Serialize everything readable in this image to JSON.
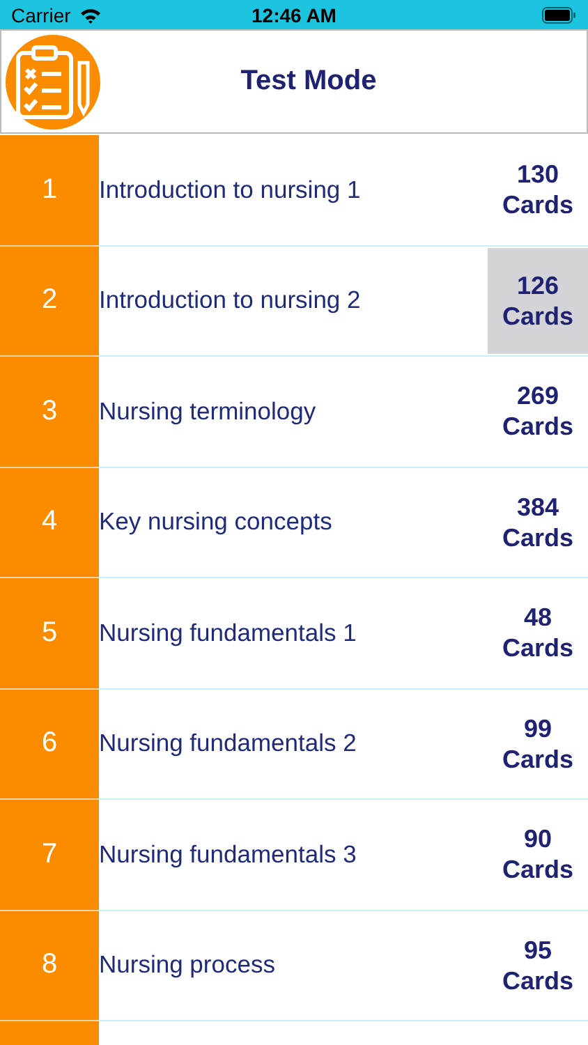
{
  "status_bar": {
    "carrier": "Carrier",
    "time": "12:46 AM"
  },
  "header": {
    "title": "Test Mode"
  },
  "decks": [
    {
      "number": "1",
      "title": "Introduction to nursing 1",
      "count": "130",
      "unit": "Cards",
      "selected": false
    },
    {
      "number": "2",
      "title": "Introduction to nursing 2",
      "count": "126",
      "unit": "Cards",
      "selected": true
    },
    {
      "number": "3",
      "title": "Nursing terminology",
      "count": "269",
      "unit": "Cards",
      "selected": false
    },
    {
      "number": "4",
      "title": "Key nursing concepts",
      "count": "384",
      "unit": "Cards",
      "selected": false
    },
    {
      "number": "5",
      "title": "Nursing fundamentals 1",
      "count": "48",
      "unit": "Cards",
      "selected": false
    },
    {
      "number": "6",
      "title": "Nursing fundamentals 2",
      "count": "99",
      "unit": "Cards",
      "selected": false
    },
    {
      "number": "7",
      "title": "Nursing fundamentals 3",
      "count": "90",
      "unit": "Cards",
      "selected": false
    },
    {
      "number": "8",
      "title": "Nursing process",
      "count": "95",
      "unit": "Cards",
      "selected": false
    }
  ]
}
